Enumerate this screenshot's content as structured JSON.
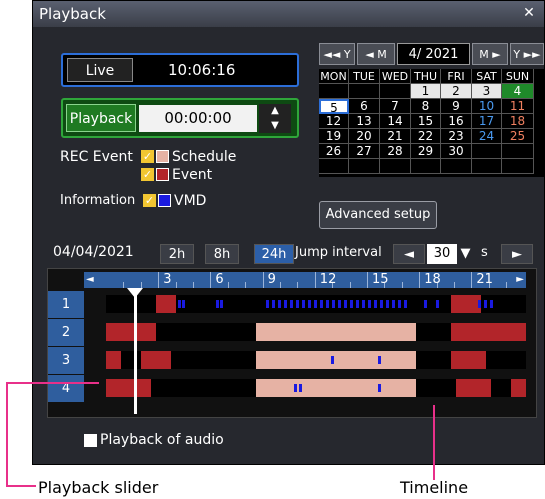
{
  "window": {
    "title": "Playback",
    "close_symbol": "✕"
  },
  "live": {
    "button": "Live",
    "time": "10:06:16"
  },
  "playback": {
    "button": "Playback",
    "time": "00:00:00",
    "spin_up": "▲",
    "spin_down": "▼"
  },
  "rec_event": {
    "label": "REC Event",
    "schedule": "Schedule",
    "event": "Event",
    "schedule_color": "#e6b2a4",
    "event_color": "#b2252a"
  },
  "information": {
    "label": "Information",
    "vmd": "VMD",
    "vmd_color": "#1a1ae0"
  },
  "calendar": {
    "prev_year": "◄◄ Y",
    "prev_month": "◄ M",
    "month": "4/ 2021",
    "next_month": "M ►",
    "next_year": "Y ►►",
    "weekdays": [
      "MON",
      "TUE",
      "WED",
      "THU",
      "FRI",
      "SAT",
      "SUN"
    ],
    "weeks": [
      [
        "",
        "",
        "",
        "1",
        "2",
        "3",
        "4"
      ],
      [
        "5",
        "6",
        "7",
        "8",
        "9",
        "10",
        "11"
      ],
      [
        "12",
        "13",
        "14",
        "15",
        "16",
        "17",
        "18"
      ],
      [
        "19",
        "20",
        "21",
        "22",
        "23",
        "24",
        "25"
      ],
      [
        "26",
        "27",
        "28",
        "29",
        "30",
        "",
        ""
      ],
      [
        "",
        "",
        "",
        "",
        "",
        "",
        ""
      ]
    ],
    "selected_day": "5",
    "today_day": "4"
  },
  "advanced_setup": "Advanced setup",
  "timeline_toolbar": {
    "date": "04/04/2021",
    "btn_2h": "2h",
    "btn_8h": "8h",
    "btn_24h": "24h",
    "jump_label": "Jump interval",
    "jump_value": "30",
    "unit": "s"
  },
  "timeline": {
    "hour_labels": [
      "3",
      "6",
      "9",
      "12",
      "15",
      "18",
      "21"
    ],
    "cameras": [
      "1",
      "2",
      "3",
      "4"
    ]
  },
  "audio": {
    "label": "Playback of audio"
  },
  "captions": {
    "slider": "Playback slider",
    "timeline": "Timeline"
  },
  "colors": {
    "accent_blue": "#2c6ed8",
    "accent_green": "#2fa63a",
    "callout": "#e8308a"
  }
}
